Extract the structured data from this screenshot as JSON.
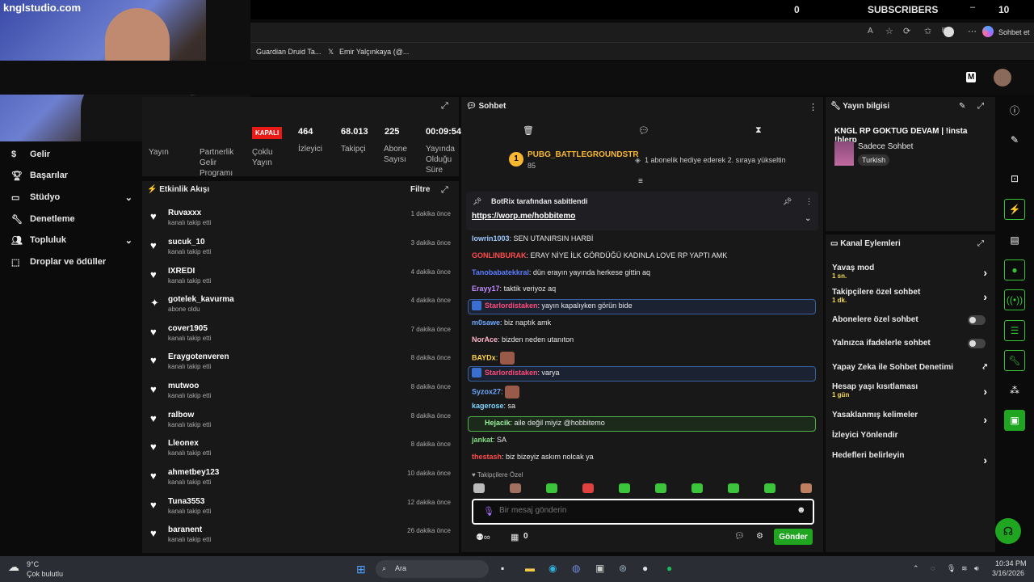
{
  "top": {
    "channel": "knglstudio.com",
    "zero": "0",
    "subscribers": "SUBSCRIBERS",
    "ten": "10"
  },
  "browser": {
    "tab1": "Guardian Druid Ta...",
    "tab2": "Emir Yalçınkaya (@...",
    "sohbet_et": "Sohbet et"
  },
  "sidebar": {
    "items": [
      {
        "label": "Gelir",
        "icon": "money-icon"
      },
      {
        "label": "Başarılar",
        "icon": "trophy-icon"
      },
      {
        "label": "Stüdyo",
        "icon": "studio-icon"
      },
      {
        "label": "Denetleme",
        "icon": "wrench-icon"
      },
      {
        "label": "Topluluk",
        "icon": "community-icon"
      },
      {
        "label": "Droplar ve ödüller",
        "icon": "drops-icon"
      }
    ]
  },
  "stats": {
    "status": "KAPALI",
    "labels": [
      "Yayın",
      "Partnerlik Gelir Programı",
      "Çoklu Yayın"
    ],
    "values": [
      {
        "value": "464",
        "label": "İzleyici"
      },
      {
        "value": "68.013",
        "label": "Takipçi"
      },
      {
        "value": "225",
        "label": "Abone Sayısı"
      },
      {
        "value": "00:09:54",
        "label": "Yayında Olduğu Süre"
      }
    ]
  },
  "activity": {
    "title": "Etkinlik Akışı",
    "filter": "Filtre",
    "items": [
      {
        "name": "Ruvaxxx",
        "sub": "kanalı takip etti",
        "time": "1 dakika önce"
      },
      {
        "name": "sucuk_10",
        "sub": "kanalı takip etti",
        "time": "3 dakika önce"
      },
      {
        "name": "IXREDI",
        "sub": "kanalı takip etti",
        "time": "4 dakika önce"
      },
      {
        "name": "gotelek_kavurma",
        "sub": "abone oldu",
        "time": "4 dakika önce"
      },
      {
        "name": "cover1905",
        "sub": "kanalı takip etti",
        "time": "7 dakika önce"
      },
      {
        "name": "Eraygotenveren",
        "sub": "kanalı takip etti",
        "time": "8 dakika önce"
      },
      {
        "name": "mutwoo",
        "sub": "kanalı takip etti",
        "time": "8 dakika önce"
      },
      {
        "name": "ralbow",
        "sub": "kanalı takip etti",
        "time": "8 dakika önce"
      },
      {
        "name": "Lleonex",
        "sub": "kanalı takip etti",
        "time": "8 dakika önce"
      },
      {
        "name": "ahmetbey123",
        "sub": "kanalı takip etti",
        "time": "10 dakika önce"
      },
      {
        "name": "Tuna3553",
        "sub": "kanalı takip etti",
        "time": "12 dakika önce"
      },
      {
        "name": "baranent",
        "sub": "kanalı takip etti",
        "time": "26 dakika önce"
      }
    ]
  },
  "chat": {
    "title": "Sohbet",
    "gift_name": "PUBG_BATTLEGROUNDSTR",
    "gift_count": "85",
    "gift_msg": "1 abonelik hediye ederek 2. sıraya yükseltin",
    "pinned_by": "BotRix tarafından sabitlendi",
    "pinned_link": "https://worp.me/hobbitemo",
    "messages": [
      {
        "user": "lowrin1003",
        "color": "#9ec9ff",
        "text": "SEN UTANIRSIN HARBİ"
      },
      {
        "user": "GONLINBURAK",
        "color": "#ff4b4b",
        "text": "ERAY NİYE İLK GÖRDÜĞÜ KADINLA LOVE RP YAPTI AMK"
      },
      {
        "user": "Tanobabatekkral",
        "color": "#5b7cff",
        "text": "dün erayın yayında herkese gittin aq"
      },
      {
        "user": "Erayy17",
        "color": "#c08cff",
        "text": "taktik veriyoz aq"
      },
      {
        "user": "Starlordistaken",
        "color": "#ff4b7a",
        "text": "yayın kapalıyken görün bide"
      },
      {
        "user": "m0sawe",
        "color": "#6ba8ff",
        "text": "biz naptık amk"
      },
      {
        "user": "NorAce",
        "color": "#ffb3c8",
        "text": "bizden neden utanıton"
      },
      {
        "user": "BAYDx",
        "color": "#ffd24a",
        "text": ""
      },
      {
        "user": "Starlordistaken",
        "color": "#ff4b7a",
        "text": "varya"
      },
      {
        "user": "Syzox27",
        "color": "#6ba8ff",
        "text": ""
      },
      {
        "user": "kagerose",
        "color": "#7fd4ff",
        "text": "sa"
      },
      {
        "user": "Hejacik",
        "color": "#9df29d",
        "text": "aile değil miyiz @hobbitemo"
      },
      {
        "user": "jankat",
        "color": "#7ee07e",
        "text": "SA"
      },
      {
        "user": "thestash",
        "color": "#ff4b4b",
        "text": "biz bizeyiz askım nolcak ya"
      }
    ],
    "followers_only": "Takipçilere Özel",
    "placeholder": "Bir mesaj gönderin",
    "points": "0",
    "send": "Gönder"
  },
  "info": {
    "title": "Yayın bilgisi",
    "stream_title": "KNGL RP GOKTUG DEVAM | !insta !blerp",
    "category": "Sadece Sohbet",
    "language": "Turkish"
  },
  "actions": {
    "title": "Kanal Eylemleri",
    "rows": [
      {
        "label": "Yavaş mod",
        "sub": "1 sn."
      },
      {
        "label": "Takipçilere özel sohbet",
        "sub": "1 dk."
      },
      {
        "label": "Abonelere özel sohbet",
        "sub": ""
      },
      {
        "label": "Yalnızca ifadelerle sohbet",
        "sub": ""
      },
      {
        "label": "Yapay Zeka ile Sohbet Denetimi",
        "sub": ""
      },
      {
        "label": "Hesap yaşı kısıtlaması",
        "sub": "1 gün"
      },
      {
        "label": "Yasaklanmış kelimeler",
        "sub": ""
      },
      {
        "label": "İzleyici Yönlendir",
        "sub": ""
      },
      {
        "label": "Hedefleri belirleyin",
        "sub": ""
      }
    ]
  },
  "taskbar": {
    "temp": "9°C",
    "weather": "Çok bulutlu",
    "search": "Ara",
    "time": "10:34 PM",
    "date": "3/16/2026"
  }
}
